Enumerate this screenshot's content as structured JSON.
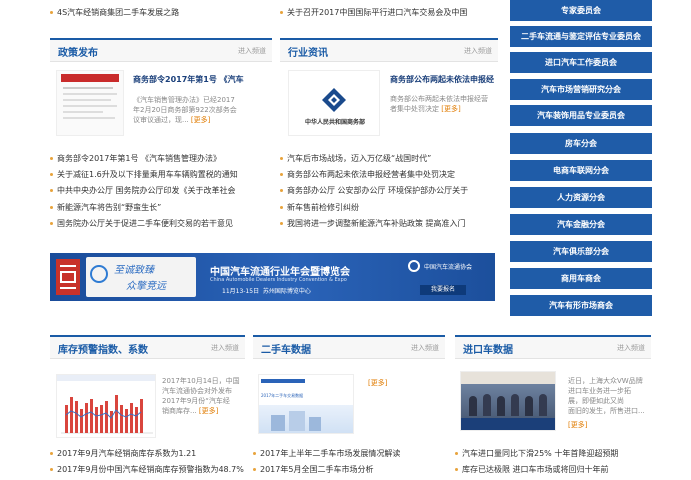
{
  "top_links": {
    "left": "4S汽车经销商集团二手车发展之路",
    "middle": "关于召开2017中国国际平行进口汽车交易会及中国"
  },
  "policy": {
    "title": "政策发布",
    "more": "进入频道",
    "feature": {
      "headline": "商务部令2017年第1号 《汽车",
      "summary_1": "《汽车销售管理办法》已经2017",
      "summary_2": "年2月20日商务部第922次部务会",
      "summary_3": "议审议通过，现...",
      "more": "[更多]"
    },
    "items": [
      "商务部令2017年第1号 《汽车销售管理办法》",
      "关于减征1.6升及以下排量乘用车车辆购置税的通知",
      "中共中央办公厅 国务院办公厅印发《关于改革社会",
      "新能源汽车将告别“野蛮生长”",
      "国务院办公厅关于促进二手车便利交易的若干意见"
    ]
  },
  "industry": {
    "title": "行业资讯",
    "more": "进入频道",
    "feature": {
      "headline": "商务部公布两起未依法申报经",
      "summary_1": "商务部公布两起未依法申报经营",
      "summary_2": "者集中处罚决定",
      "more": "[更多]",
      "logo_caption": "中华人民共和国商务部"
    },
    "items": [
      "汽车后市场战场，迈入万亿级“战国时代”",
      "商务部公布两起未依法申报经营者集中处罚决定",
      "商务部办公厅 公安部办公厅 环境保护部办公厅关于",
      "新车售前检修引纠纷",
      "我国将进一步调整新能源汽车补贴政策 提高准入门"
    ]
  },
  "banner": {
    "slogan_1": "至诚致臻",
    "slogan_2": "众擎竞远",
    "title": "中国汽车流通行业年会暨博览会",
    "subtitle": "China Automobile Dealers Industry Convention & Expo",
    "date": "11月13-15日",
    "venue": "苏州国际博览中心",
    "org": "中国汽车流通协会",
    "button": "我要报名"
  },
  "inventory": {
    "title": "库存预警指数、系数",
    "more": "进入频道",
    "summary_1": "2017年10月14日，中国",
    "summary_2": "汽车流通协会对外发布",
    "summary_3": "2017年9月份“汽车经",
    "summary_4": "销商库存...",
    "more_tag": "[更多]",
    "items": [
      "2017年9月汽车经销商库存系数为1.21",
      "2017年9月份中国汽车经销商库存预警指数为48.7%"
    ]
  },
  "used_car": {
    "title": "二手车数据",
    "more": "进入频道",
    "more_tag": "[更多]",
    "thumb_caption": "2017年二手车交易数据",
    "items": [
      "2017年上半年二手车市场发展情况解读",
      "2017年5月全国二手车市场分析"
    ]
  },
  "import_car": {
    "title": "进口车数据",
    "more": "进入频道",
    "summary_1": "近日，上海大众VW品牌",
    "summary_2": "进口车业务进一步拓",
    "summary_3": "展，即便如此又尚",
    "summary_4": "面旧的发生，所售进口...",
    "more_tag": "[更多]",
    "items": [
      "汽车进口量同比下滑25% 十年首降迎超预期",
      "库存已达极限 进口车市场或将回归十年前"
    ]
  },
  "right_menu": [
    "专家委员会",
    "二手车流通与鉴定评估专业委员会",
    "进口汽车工作委员会",
    "汽车市场营销研究分会",
    "汽车装饰用品专业委员会",
    "房车分会",
    "电商车联网分会",
    "人力资源分会",
    "汽车金融分会",
    "汽车俱乐部分会",
    "商用车商会",
    "汽车有形市场商会"
  ],
  "colors": {
    "brand_blue": "#1f5ca8",
    "accent_orange": "#e07b00",
    "banner_bg": "#1c4f9c"
  }
}
